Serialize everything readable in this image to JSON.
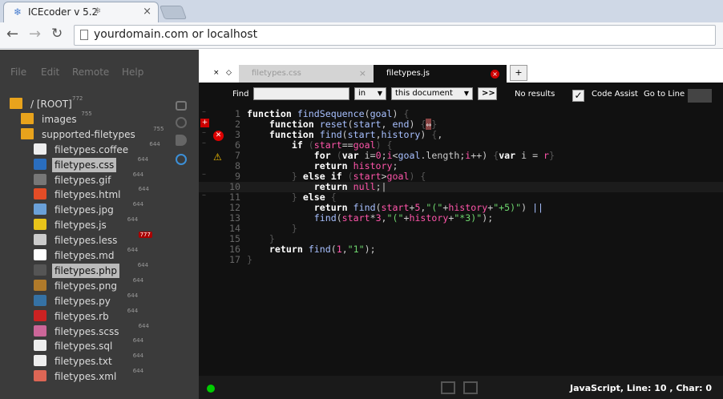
{
  "browser": {
    "tab_title": "ICEcoder v 5.2",
    "url_text": "yourdomain.com or localhost"
  },
  "menu": [
    "File",
    "Edit",
    "Remote",
    "Help"
  ],
  "tree": [
    {
      "name": "/ [ROOT]",
      "perm": "772",
      "icon": "folder-icon",
      "level": 0
    },
    {
      "name": "images",
      "perm": "755",
      "icon": "folder-icon",
      "level": 1
    },
    {
      "name": "supported-filetypes",
      "perm": "755",
      "icon": "folder-icon",
      "level": 1
    },
    {
      "name": "filetypes.coffee",
      "perm": "644",
      "icon": "coffee-icon",
      "level": 2
    },
    {
      "name": "filetypes.css",
      "perm": "644",
      "icon": "css3-icon",
      "level": 2,
      "highlight": true
    },
    {
      "name": "filetypes.gif",
      "perm": "644",
      "icon": "gif-icon",
      "level": 2
    },
    {
      "name": "filetypes.html",
      "perm": "644",
      "icon": "html5-icon",
      "level": 2
    },
    {
      "name": "filetypes.jpg",
      "perm": "644",
      "icon": "image-icon",
      "level": 2
    },
    {
      "name": "filetypes.js",
      "perm": "644",
      "icon": "js-icon",
      "level": 2
    },
    {
      "name": "filetypes.less",
      "perm": "777",
      "icon": "less-icon",
      "level": 2,
      "perm_warning": true
    },
    {
      "name": "filetypes.md",
      "perm": "644",
      "icon": "markdown-icon",
      "level": 2
    },
    {
      "name": "filetypes.php",
      "perm": "644",
      "icon": "php-icon",
      "level": 2,
      "highlight": true
    },
    {
      "name": "filetypes.png",
      "perm": "644",
      "icon": "cookie-icon",
      "level": 2
    },
    {
      "name": "filetypes.py",
      "perm": "644",
      "icon": "python-icon",
      "level": 2
    },
    {
      "name": "filetypes.rb",
      "perm": "644",
      "icon": "ruby-icon",
      "level": 2
    },
    {
      "name": "filetypes.scss",
      "perm": "644",
      "icon": "sass-icon",
      "level": 2
    },
    {
      "name": "filetypes.sql",
      "perm": "644",
      "icon": "sql-icon",
      "level": 2
    },
    {
      "name": "filetypes.txt",
      "perm": "644",
      "icon": "text-file-icon",
      "level": 2
    },
    {
      "name": "filetypes.xml",
      "perm": "644",
      "icon": "xml-icon",
      "level": 2
    }
  ],
  "tabs": [
    {
      "label": "filetypes.css",
      "active": false
    },
    {
      "label": "filetypes.js",
      "active": true
    }
  ],
  "tab_controls": {
    "close_all": "×",
    "view": "◇",
    "add": "+"
  },
  "find": {
    "label": "Find",
    "value": "",
    "scope1": "in",
    "scope2": "this document",
    "go": ">>",
    "result": "No results",
    "code_assist": "Code Assist",
    "goto": "Go to Line"
  },
  "code_lines": [
    {
      "n": "1",
      "html": "<span class='k'>function</span> <span class='f'>findSequence</span>(<span class='f'>goal</span>) <span class='p'>{</span>"
    },
    {
      "n": "2",
      "html": "    <span class='k'>function</span> <span class='f'>reset</span>(<span class='f'>start</span>, <span class='f'>end</span>) <span class='p'>{</span><span style='background:#844;color:#ddd'>⇔</span><span class='p'>}</span>"
    },
    {
      "n": "3",
      "html": "    <span class='k'>function</span> <span class='f'>find</span>(<span class='f'>start</span>,<span class='f'>history</span>) <span class='p'>{</span>,"
    },
    {
      "n": "6",
      "html": "        <span class='k'>if</span> <span class='p'>(</span><span class='v'>start</span>==<span class='v'>goal</span><span class='p'>) {</span>"
    },
    {
      "n": "7",
      "html": "            <span class='k'>for</span> <span class='p'>(</span><span class='k'>var</span> i=<span class='v'>0</span>;<span class='v'>i</span>&lt;<span class='f'>goal</span>.length;<span class='v'>i</span>++) <span class='p'>{</span><span class='k'>var</span> i = <span class='v'>r</span><span class='p'>}</span>"
    },
    {
      "n": "8",
      "html": "            <span class='k'>return</span> <span class='v'>history</span>;"
    },
    {
      "n": "9",
      "html": "        <span class='p'>}</span> <span class='k'>else if</span> <span class='p'>(</span><span class='v'>start</span>&gt;<span class='v'>goal</span><span class='p'>) {</span>"
    },
    {
      "n": "10",
      "html": "            <span class='k'>return</span> <span class='v'>null</span>;|"
    },
    {
      "n": "11",
      "html": "        <span class='p'>}</span> <span class='k'>else</span> <span class='p'>{</span>"
    },
    {
      "n": "12",
      "html": "            <span class='k'>return</span> <span class='f'>find</span>(<span class='v'>start</span>+<span class='v'>5</span>,<span class='s'>\"(\"</span>+<span class='v'>history</span>+<span class='s'>\"+5)\"</span>) <span class='f'>||</span>"
    },
    {
      "n": "13",
      "html": "            <span class='f'>find</span>(<span class='v'>start</span>*<span class='v'>3</span>,<span class='s'>\"(\"</span>+<span class='v'>history</span>+<span class='s'>\"*3)\"</span>);"
    },
    {
      "n": "14",
      "html": "        <span class='p'>}</span>"
    },
    {
      "n": "15",
      "html": "    <span class='p'>}</span>"
    },
    {
      "n": "16",
      "html": "    <span class='k'>return</span> <span class='f'>find</span>(<span class='v'>1</span>,<span class='s'>\"1\"</span>);"
    },
    {
      "n": "17",
      "html": "<span class='p'>}</span>"
    }
  ],
  "status": {
    "info": "JavaScript, Line: 10 , Char: 0"
  }
}
